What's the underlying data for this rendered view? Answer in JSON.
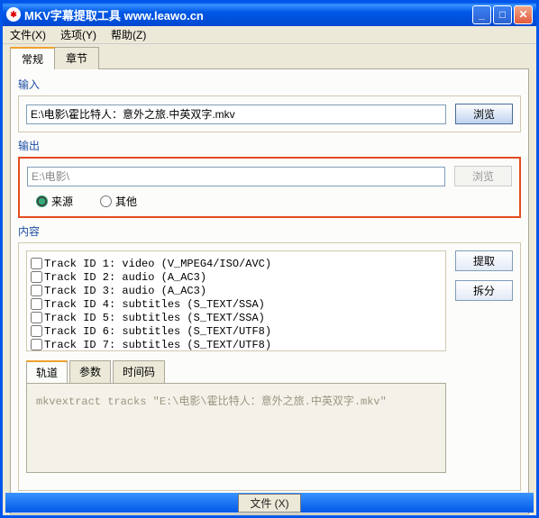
{
  "window": {
    "title": "MKV字幕提取工具   www.leawo.cn"
  },
  "menus": {
    "file": "文件(X)",
    "options": "选项(Y)",
    "help": "帮助(Z)"
  },
  "tabs": {
    "general": "常规",
    "chapters": "章节"
  },
  "input": {
    "label": "输入",
    "path": "E:\\电影\\霍比特人：意外之旅.中英双字.mkv",
    "browse": "浏览"
  },
  "output": {
    "label": "输出",
    "path": "E:\\电影\\",
    "browse": "浏览",
    "source": "来源",
    "other": "其他"
  },
  "content": {
    "label": "内容",
    "extract": "提取",
    "split": "拆分",
    "tracks": [
      "Track ID 1: video (V_MPEG4/ISO/AVC)",
      "Track ID 2: audio (A_AC3)",
      "Track ID 3: audio (A_AC3)",
      "Track ID 4: subtitles (S_TEXT/SSA)",
      "Track ID 5: subtitles (S_TEXT/SSA)",
      "Track ID 6: subtitles (S_TEXT/UTF8)",
      "Track ID 7: subtitles (S_TEXT/UTF8)"
    ],
    "innerTabs": {
      "track": "轨道",
      "params": "参数",
      "timecode": "时间码"
    },
    "command": "mkvextract tracks \"E:\\电影\\霍比特人：意外之旅.中英双字.mkv\""
  },
  "status": {
    "file": "文件 (X)"
  }
}
